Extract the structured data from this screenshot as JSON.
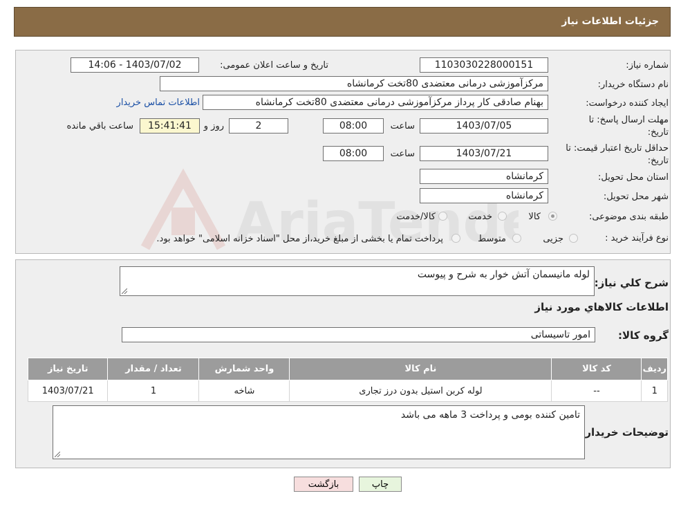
{
  "header": {
    "title": "جزئیات اطلاعات نیاز"
  },
  "form": {
    "need_number_label": "شماره نیاز:",
    "need_number": "1103030228000151",
    "announce_label": "تاریخ و ساعت اعلان عمومی:",
    "announce_value": "1403/07/02 - 14:06",
    "buyer_org_label": "نام دستگاه خریدار:",
    "buyer_org": "مرکزآموزشی درمانی معتضدی 80تخت کرمانشاه",
    "creator_label": "ایجاد کننده درخواست:",
    "creator": "بهنام صادقی کار پرداز مرکزآموزشی درمانی معتضدی 80تخت کرمانشاه",
    "contact_link": "اطلاعات تماس خریدار",
    "deadline_label_1": "مهلت ارسال پاسخ: تا",
    "deadline_label_2": "تاریخ:",
    "deadline_date": "1403/07/05",
    "hour_label": "ساعت",
    "deadline_time": "08:00",
    "days_value": "2",
    "days_label": "روز و",
    "remaining_time": "15:41:41",
    "remaining_label": "ساعت باقي مانده",
    "validity_label_1": "حداقل تاریخ اعتبار قیمت: تا",
    "validity_label_2": "تاریخ:",
    "validity_date": "1403/07/21",
    "validity_time": "08:00",
    "province_label": "استان محل تحویل:",
    "province": "کرمانشاه",
    "city_label": "شهر محل تحویل:",
    "city": "کرمانشاه",
    "category_label": "طبقه بندی موضوعی:",
    "category_options": [
      "کالا",
      "خدمت",
      "کالا/خدمت"
    ],
    "category_selected": "کالا",
    "process_label": "نوع فرآیند خرید :",
    "process_options": [
      "جزیی",
      "متوسط"
    ],
    "process_note": "پرداخت تمام یا بخشی از مبلغ خرید،از محل \"اسناد خزانه اسلامی\" خواهد بود."
  },
  "details": {
    "summary_label": "شرح کلي نياز:",
    "summary": "لوله مانیسمان آتش خوار به شرح و پیوست",
    "goods_heading": "اطلاعات کالاهاي مورد نياز",
    "group_label": "گروه کالا:",
    "group": "امور تاسیساتی",
    "table": {
      "headers": [
        "رديف",
        "کد کالا",
        "نام کالا",
        "واحد شمارش",
        "تعداد / مقدار",
        "تاريخ نياز"
      ],
      "rows": [
        [
          "1",
          "--",
          "لوله کربن استیل بدون درز تجاری",
          "شاخه",
          "1",
          "1403/07/21"
        ]
      ]
    },
    "buyer_notes_label": "توضيحات خريدار:",
    "buyer_notes": "تامین کننده بومی و پرداخت 3 ماهه می باشد"
  },
  "buttons": {
    "print": "چاپ",
    "back": "بازگشت"
  },
  "watermark": {
    "brand_text": "AriaTender.neT"
  },
  "colors": {
    "header": "#8a6c46",
    "back_button": "#f7dede",
    "print_button": "#e7f5dd",
    "table_header": "#9c9c9c"
  }
}
